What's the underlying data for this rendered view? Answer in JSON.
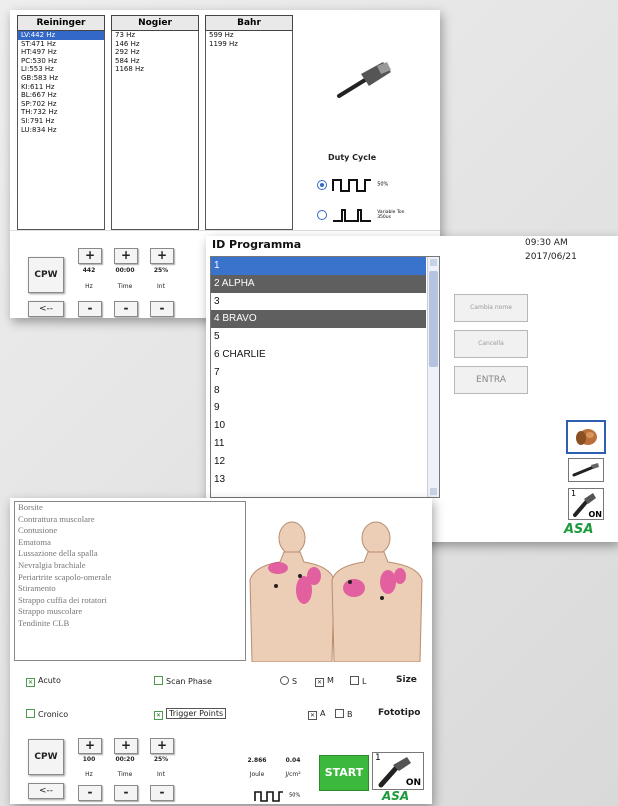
{
  "freq_panel": {
    "columns": [
      {
        "header": "Reininger",
        "items": [
          "LV:442 Hz",
          "ST:471 Hz",
          "HT:497 Hz",
          "PC:530 Hz",
          "LI:553 Hz",
          "GB:583 Hz",
          "KI:611 Hz",
          "BL:667 Hz",
          "SP:702 Hz",
          "TH:732 Hz",
          "SI:791 Hz",
          "LU:834 Hz"
        ],
        "selected": 0
      },
      {
        "header": "Nogier",
        "items": [
          "73 Hz",
          "146 Hz",
          "292 Hz",
          "584 Hz",
          "1168 Hz"
        ]
      },
      {
        "header": "Bahr",
        "items": [
          "599 Hz",
          "1199 Hz"
        ]
      }
    ],
    "duty_cycle": {
      "title": "Duty Cycle",
      "option1_value": "50%",
      "option2_label": "Variable Ton 350us",
      "selected": 0
    },
    "cpw_label": "CPW",
    "back_label": "<--",
    "steppers": [
      {
        "value": "442",
        "label": "Hz"
      },
      {
        "value": "00:00",
        "label": "Time"
      },
      {
        "value": "25%",
        "label": "Int"
      }
    ]
  },
  "program_panel": {
    "title": "ID Programma",
    "time": "09:30 AM",
    "date": "2017/06/21",
    "rows": [
      {
        "text": "1",
        "state": "selected"
      },
      {
        "text": "2  ALPHA",
        "state": "dark"
      },
      {
        "text": "3",
        "state": ""
      },
      {
        "text": "4  BRAVO",
        "state": "dark"
      },
      {
        "text": "5",
        "state": ""
      },
      {
        "text": "6  CHARLIE",
        "state": ""
      },
      {
        "text": "7",
        "state": ""
      },
      {
        "text": "8",
        "state": ""
      },
      {
        "text": "9",
        "state": ""
      },
      {
        "text": "10",
        "state": ""
      },
      {
        "text": "11",
        "state": ""
      },
      {
        "text": "12",
        "state": ""
      },
      {
        "text": "13",
        "state": ""
      }
    ],
    "buttons": {
      "rename": "Cambia nome",
      "delete": "Cancella",
      "enter": "ENTRA"
    },
    "probe_badge_num": "1",
    "probe_badge_text": "ON",
    "logo": "ASA"
  },
  "treatment_panel": {
    "conditions": [
      "Borsite",
      "Contrattura muscolare",
      "Contusione",
      "Ematoma",
      "Lussazione della spalla",
      "Nevralgia brachiale",
      "Periartrite scapolo-omerale",
      "Stiramento",
      "Strappo cuffia dei rotatori",
      "Strappo muscolare",
      "Tendinite CLB"
    ],
    "acuto": "Acuto",
    "cronico": "Cronico",
    "scan_phase": "Scan Phase",
    "trigger_points": "Trigger Points",
    "size_label": "Size",
    "size_options": [
      "S",
      "M",
      "L"
    ],
    "size_selected": "M",
    "fototipo_label": "Fototipo",
    "fototipo_options": [
      "A",
      "B"
    ],
    "fototipo_selected": "A",
    "cpw_label": "CPW",
    "back_label": "<--",
    "steppers": [
      {
        "value": "100",
        "label": "Hz"
      },
      {
        "value": "00:20",
        "label": "Time"
      },
      {
        "value": "25%",
        "label": "Int"
      }
    ],
    "energy_value": "2.866",
    "energy_unit": "Joule",
    "density_value": "0.04",
    "density_unit": "J/cm²",
    "pulse_value": "50%",
    "start_label": "START",
    "probe_badge_num": "1",
    "probe_badge_text": "ON",
    "logo": "ASA",
    "colors": {
      "start": "#3cb83c",
      "selection": "#3468c8",
      "accent_pink": "#e0459a"
    }
  }
}
